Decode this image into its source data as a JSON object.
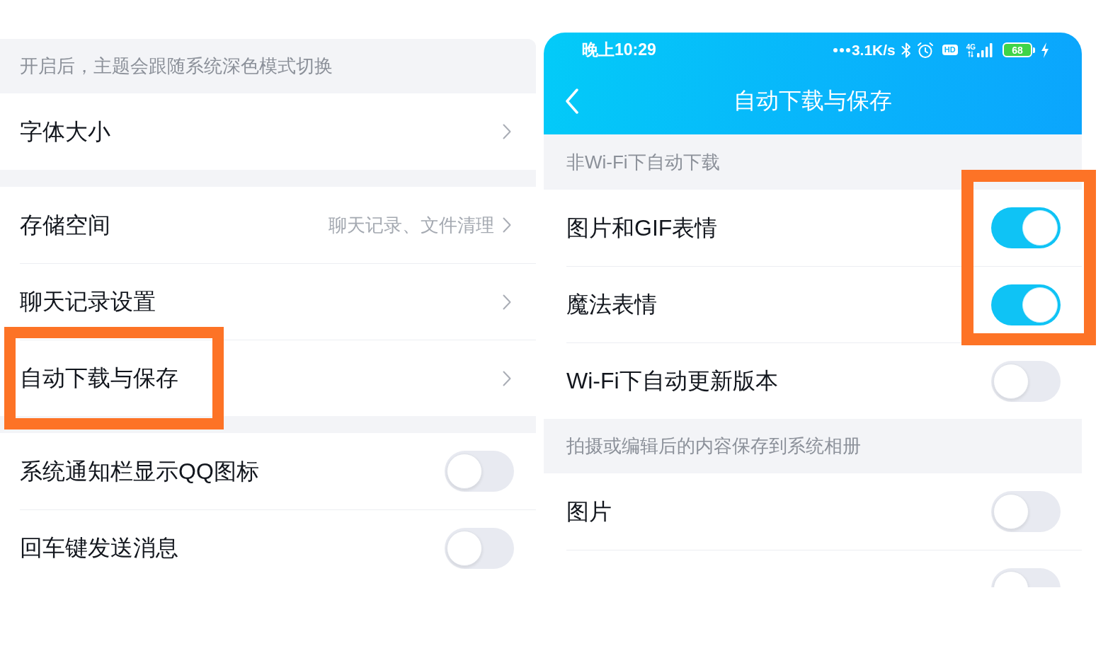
{
  "left_panel": {
    "note": "开启后，主题会跟随系统深色模式切换",
    "groups": [
      {
        "items": [
          {
            "kind": "link",
            "label": "字体大小",
            "highlighted": false
          }
        ]
      },
      {
        "items": [
          {
            "kind": "link",
            "label": "存储空间",
            "value": "聊天记录、文件清理",
            "highlighted": false
          },
          {
            "kind": "link",
            "label": "聊天记录设置",
            "highlighted": false
          },
          {
            "kind": "link",
            "label": "自动下载与保存",
            "highlighted": true
          }
        ]
      },
      {
        "items": [
          {
            "kind": "toggle",
            "label": "系统通知栏显示QQ图标",
            "on": false,
            "highlighted": false
          },
          {
            "kind": "toggle",
            "label": "回车键发送消息",
            "on": false,
            "highlighted": false
          }
        ]
      }
    ]
  },
  "right_panel": {
    "status_bar": {
      "time": "晚上10:29",
      "net_speed": "3.1K/s",
      "hd_badge": "HD",
      "network": "4G",
      "battery": "68"
    },
    "title": "自动下载与保存",
    "sections": [
      {
        "header": "非Wi-Fi下自动下载",
        "items": [
          {
            "kind": "toggle",
            "label": "图片和GIF表情",
            "on": true,
            "highlighted": true
          },
          {
            "kind": "toggle",
            "label": "魔法表情",
            "on": true,
            "highlighted": true
          },
          {
            "kind": "toggle",
            "label": "Wi-Fi下自动更新版本",
            "on": false,
            "highlighted": false
          }
        ]
      },
      {
        "header": "拍摄或编辑后的内容保存到系统相册",
        "items": [
          {
            "kind": "toggle",
            "label": "图片",
            "on": false,
            "highlighted": false
          },
          {
            "kind": "toggle",
            "on": false,
            "highlighted": false
          }
        ]
      }
    ]
  }
}
